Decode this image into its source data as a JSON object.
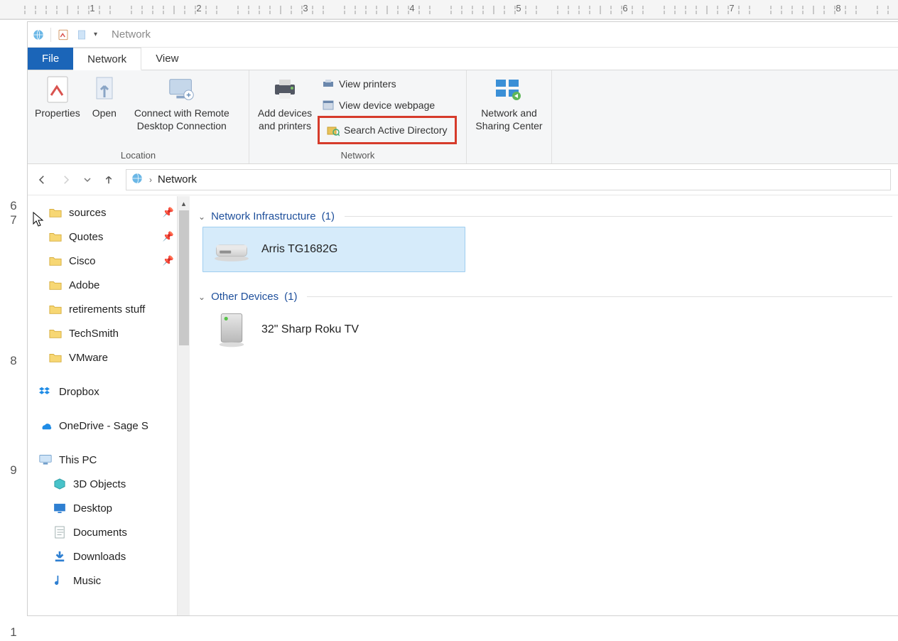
{
  "window": {
    "title": "Network"
  },
  "tabs": {
    "file": "File",
    "network": "Network",
    "view": "View"
  },
  "ribbon": {
    "location": {
      "label": "Location",
      "properties": "Properties",
      "open": "Open",
      "remote": "Connect with Remote\nDesktop Connection"
    },
    "network": {
      "label": "Network",
      "add": "Add devices\nand printers",
      "view_printers": "View printers",
      "view_webpage": "View device webpage",
      "search_ad": "Search Active Directory",
      "nsc": "Network and\nSharing Center"
    }
  },
  "breadcrumb": {
    "root": "Network"
  },
  "sidebar": {
    "items": [
      {
        "label": "sources",
        "pinned": true,
        "kind": "folder"
      },
      {
        "label": "Quotes",
        "pinned": true,
        "kind": "folder"
      },
      {
        "label": "Cisco",
        "pinned": true,
        "kind": "folder"
      },
      {
        "label": "Adobe",
        "pinned": false,
        "kind": "folder"
      },
      {
        "label": "retirements stuff",
        "pinned": false,
        "kind": "folder"
      },
      {
        "label": "TechSmith",
        "pinned": false,
        "kind": "folder"
      },
      {
        "label": "VMware",
        "pinned": false,
        "kind": "folder"
      }
    ],
    "dropbox": "Dropbox",
    "onedrive": "OneDrive - Sage S",
    "thispc": "This PC",
    "pc_children": [
      {
        "label": "3D Objects",
        "kind": "3d"
      },
      {
        "label": "Desktop",
        "kind": "desktop"
      },
      {
        "label": "Documents",
        "kind": "docs"
      },
      {
        "label": "Downloads",
        "kind": "downloads"
      },
      {
        "label": "Music",
        "kind": "music"
      }
    ]
  },
  "content": {
    "groups": [
      {
        "name": "Network Infrastructure",
        "count": "(1)",
        "items": [
          {
            "name": "Arris TG1682G",
            "selected": true,
            "icon": "router"
          }
        ]
      },
      {
        "name": "Other Devices",
        "count": "(1)",
        "items": [
          {
            "name": "32\" Sharp Roku TV",
            "selected": false,
            "icon": "device"
          }
        ]
      }
    ]
  },
  "ruler": {
    "v": [
      "6",
      "7",
      "",
      "8",
      "",
      "9",
      "",
      "1"
    ]
  }
}
